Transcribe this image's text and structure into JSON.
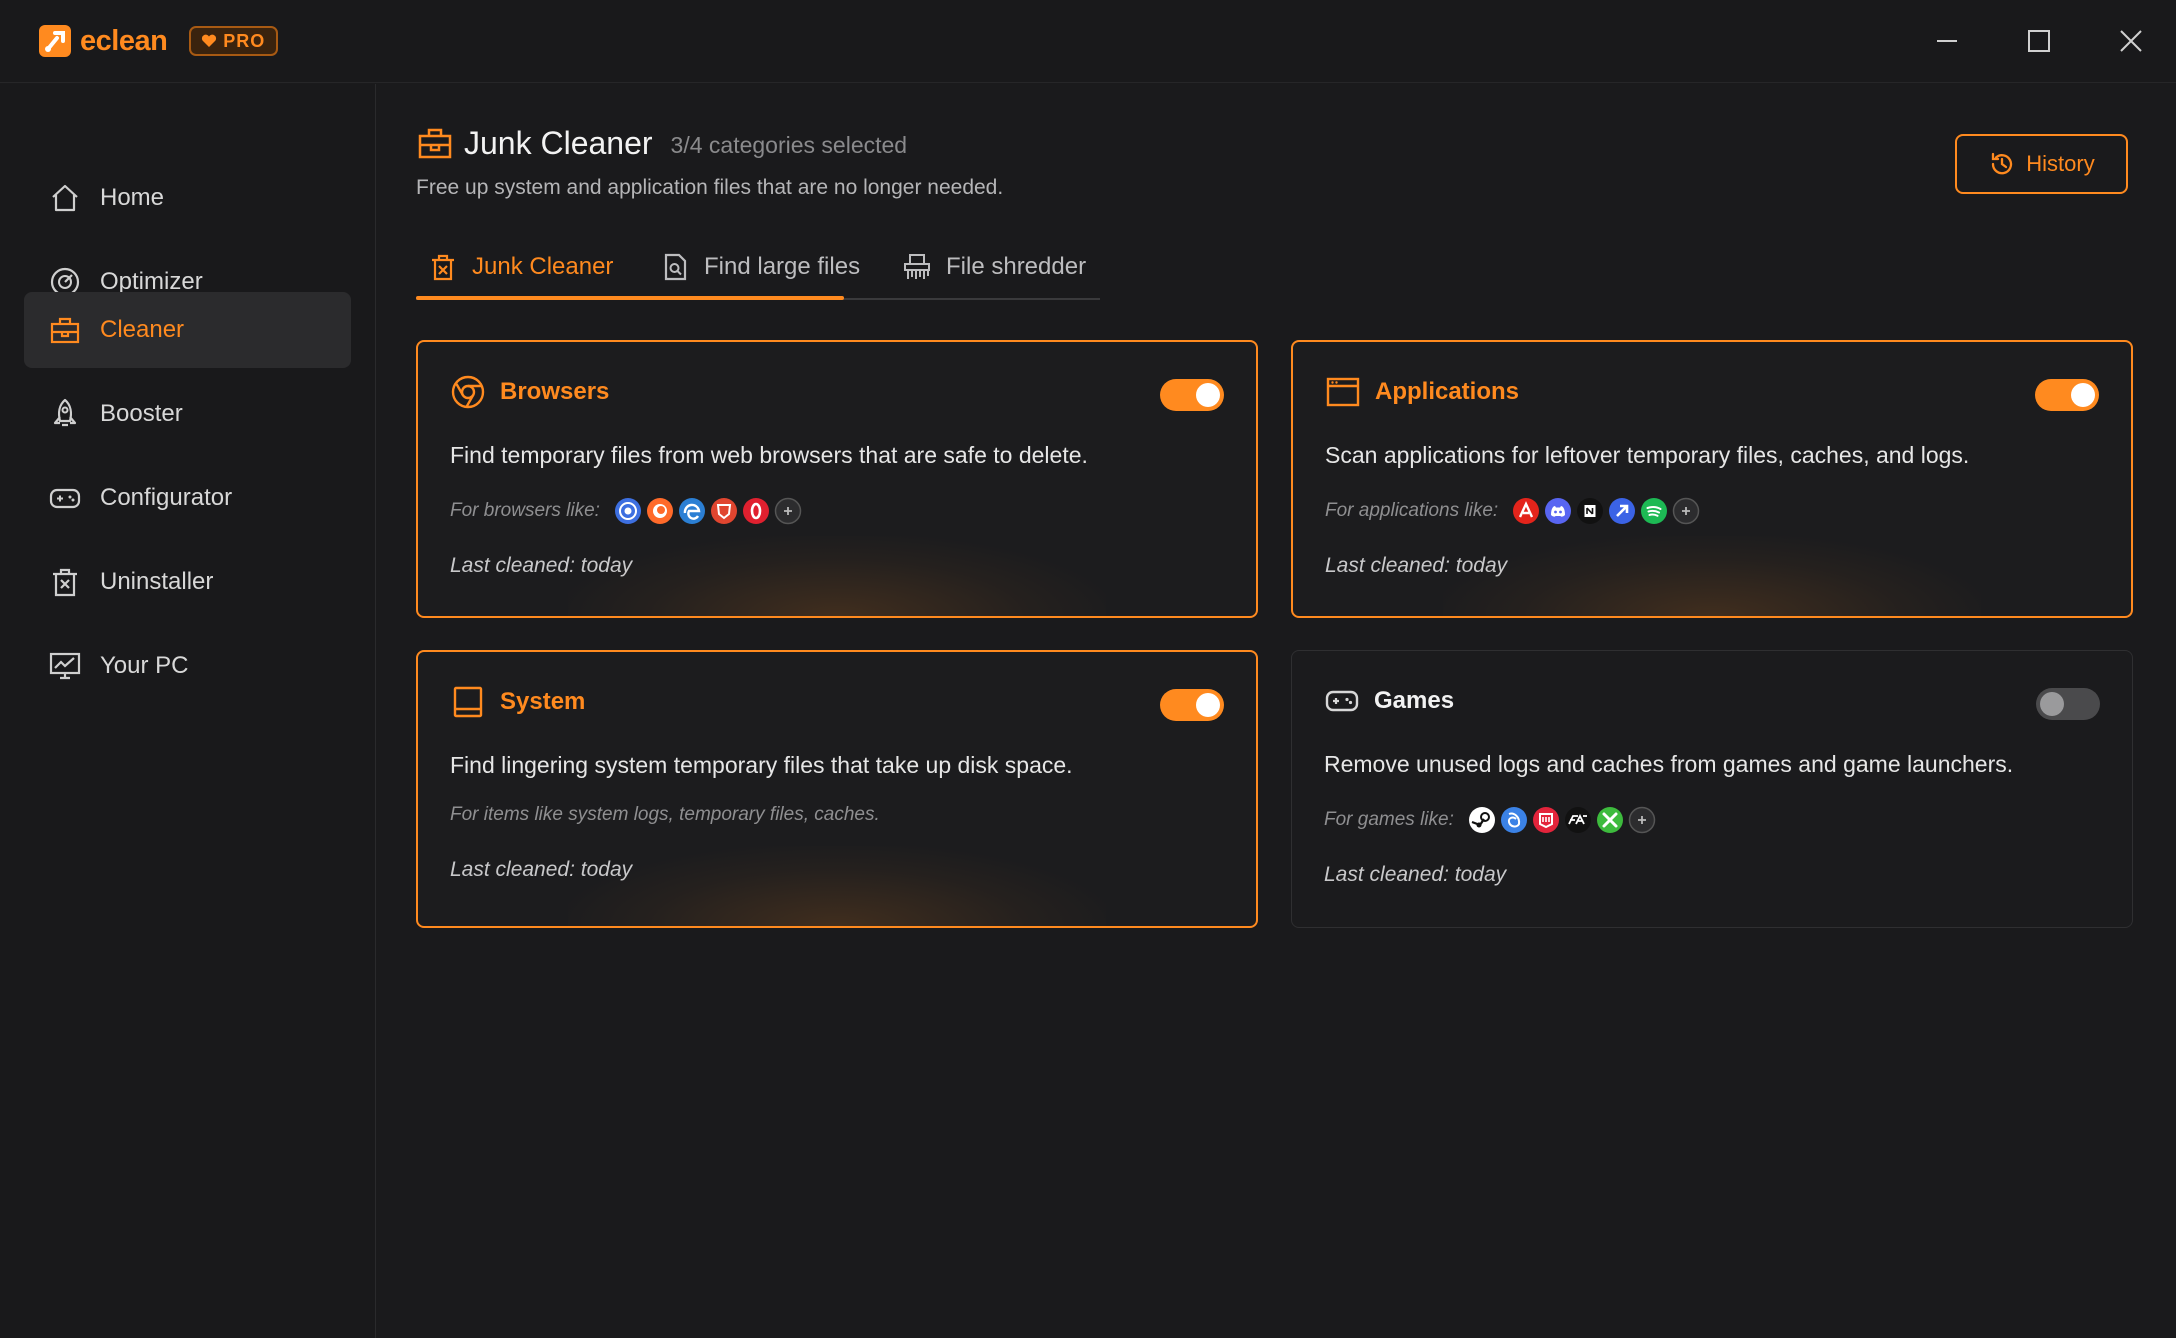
{
  "app": {
    "name": "eclean",
    "badge": "PRO"
  },
  "sidebar": {
    "items": [
      {
        "label": "Home",
        "icon": "home-icon"
      },
      {
        "label": "Optimizer",
        "icon": "gauge-icon"
      },
      {
        "label": "Cleaner",
        "icon": "toolbox-icon",
        "active": true
      },
      {
        "label": "Booster",
        "icon": "rocket-icon"
      },
      {
        "label": "Configurator",
        "icon": "gamepad-icon"
      },
      {
        "label": "Uninstaller",
        "icon": "trash-icon"
      },
      {
        "label": "Your PC",
        "icon": "monitor-chart-icon"
      }
    ]
  },
  "header": {
    "title": "Junk Cleaner",
    "count": "3/4 categories selected",
    "subtitle": "Free up system and application files that are no longer needed.",
    "history_label": "History"
  },
  "tabs": [
    {
      "label": "Junk Cleaner",
      "icon": "trash-tab-icon",
      "active": true
    },
    {
      "label": "Find large files",
      "icon": "file-search-icon"
    },
    {
      "label": "File shredder",
      "icon": "shredder-icon"
    }
  ],
  "cards": [
    {
      "title": "Browsers",
      "enabled": true,
      "description": "Find temporary files from web browsers that are safe to delete.",
      "like_label": "For browsers like:",
      "apps": [
        "chrome-icon",
        "firefox-icon",
        "edge-icon",
        "brave-icon",
        "opera-icon",
        "more-icon"
      ],
      "last_cleaned": "Last cleaned: today"
    },
    {
      "title": "Applications",
      "enabled": true,
      "description": "Scan applications for leftover temporary files, caches, and logs.",
      "like_label": "For applications like:",
      "apps": [
        "adobe-icon",
        "discord-icon",
        "notion-icon",
        "zoom-icon",
        "spotify-icon",
        "more-icon"
      ],
      "last_cleaned": "Last cleaned: today"
    },
    {
      "title": "System",
      "enabled": true,
      "description": "Find lingering system temporary files that take up disk space.",
      "like_label": "For items like system logs, temporary files, caches.",
      "apps": [],
      "last_cleaned": "Last cleaned: today"
    },
    {
      "title": "Games",
      "enabled": false,
      "description": "Remove unused logs and caches from games and game launchers.",
      "like_label": "For games like:",
      "apps": [
        "steam-icon",
        "battlenet-icon",
        "epic-icon",
        "ea-icon",
        "xbox-icon",
        "more-icon"
      ],
      "last_cleaned": "Last cleaned: today"
    }
  ],
  "colors": {
    "accent": "#ff8a1f",
    "background": "#1a1a1c",
    "card_off_border": "#2f2f31"
  }
}
